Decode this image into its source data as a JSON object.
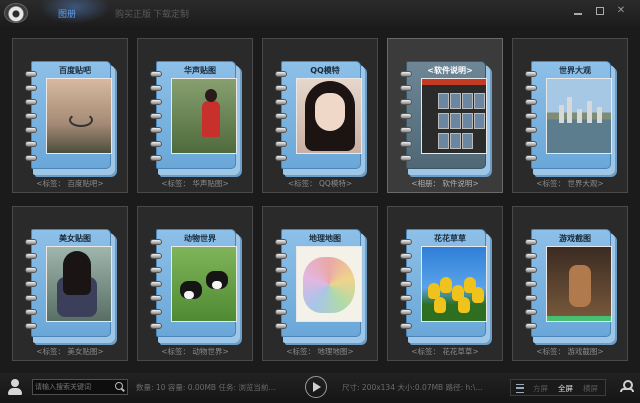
{
  "titlebar": {
    "tabs": [
      {
        "label": "图册",
        "active": true
      },
      {
        "label": "购买正版",
        "active": false
      },
      {
        "label": "下载定制",
        "active": false
      }
    ]
  },
  "albums": [
    {
      "title": "百度贴吧",
      "caption": "<标签：   百度贴吧>",
      "photo": "tattoo-shoulder-photo"
    },
    {
      "title": "华声贴图",
      "caption": "<标签：   华声贴图>",
      "photo": "girl-street-photo"
    },
    {
      "title": "QQ模特",
      "caption": "<标签：   QQ模特>",
      "photo": "girl-portrait-photo"
    },
    {
      "title": "<软件说明>",
      "caption": "<相册：   软件说明>",
      "photo": "software-screenshot",
      "selected": true
    },
    {
      "title": "世界大观",
      "caption": "<标签：   世界大观>",
      "photo": "city-skyline-photo"
    },
    {
      "title": "美女贴图",
      "caption": "<标签：   美女贴图>",
      "photo": "girl-bicycle-photo"
    },
    {
      "title": "动物世界",
      "caption": "<标签：   动物世界>",
      "photo": "dogs-grass-photo"
    },
    {
      "title": "地理地图",
      "caption": "<标签：   地理地图>",
      "photo": "china-map-photo"
    },
    {
      "title": "花花草草",
      "caption": "<标签：   花花草草>",
      "photo": "yellow-tulips-photo"
    },
    {
      "title": "游戏截图",
      "caption": "<标签：   游戏截图>",
      "photo": "game-screenshot-photo"
    }
  ],
  "statusbar": {
    "search_placeholder": "请输入搜索关键词",
    "stats": "数量: 10 容量: 0.00MB 任务: 浏览当前...",
    "image_info": "尺寸: 200x134 大小:0.07MB 路径: h:\\...",
    "view_options": [
      {
        "label": "方屏",
        "active": false
      },
      {
        "label": "全屏",
        "active": true
      },
      {
        "label": "横屏",
        "active": false
      }
    ]
  },
  "colors": {
    "accent": "#5fa0e6",
    "book_blue": "#7ab3df",
    "background": "#1b1b1b"
  }
}
